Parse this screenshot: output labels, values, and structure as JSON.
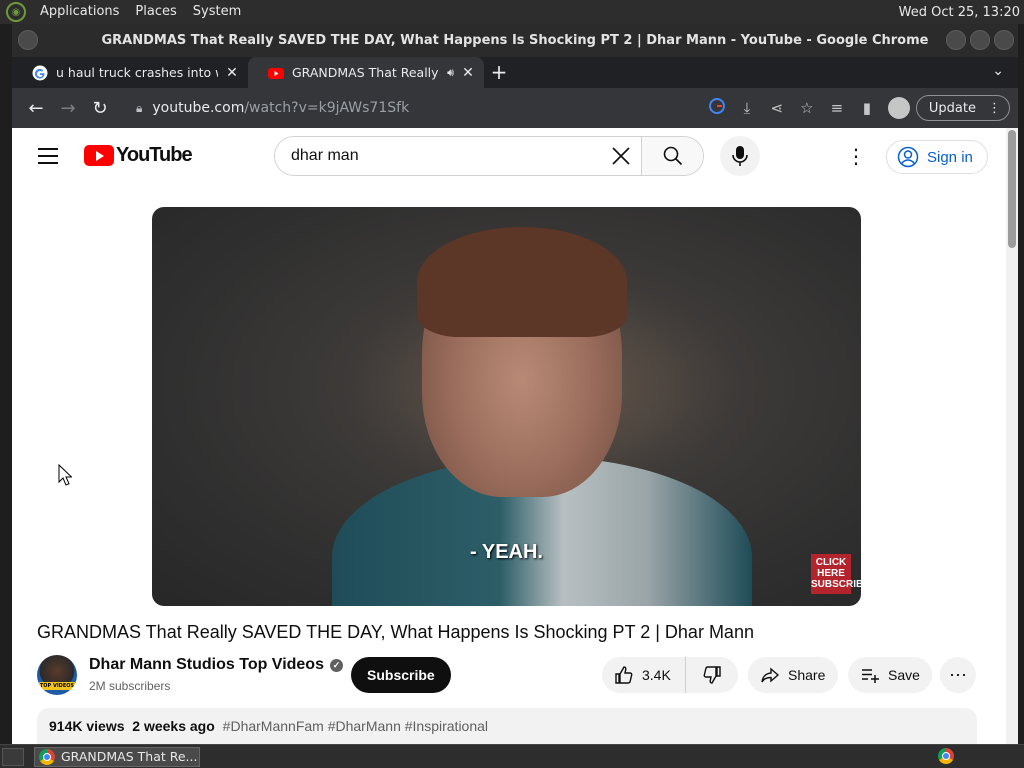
{
  "system_panel": {
    "menus": [
      "Applications",
      "Places",
      "System"
    ],
    "clock": "Wed Oct 25, 13:20"
  },
  "window": {
    "title": "GRANDMAS That Really SAVED THE DAY, What Happens Is Shocking PT 2 | Dhar Mann - YouTube - Google Chrome"
  },
  "tabs": [
    {
      "title": "u haul truck crashes into white",
      "icon": "google-icon",
      "active": false
    },
    {
      "title": "GRANDMAS That Really SAVED",
      "icon": "youtube-icon",
      "active": true,
      "audio": true
    }
  ],
  "toolbar": {
    "url_host": "youtube.com",
    "url_path": "/watch?v=k9jAWs71Sfk",
    "update_label": "Update"
  },
  "youtube": {
    "logo_text": "YouTube",
    "search_value": "dhar man",
    "signin_label": "Sign in",
    "video": {
      "subtitle": "- YEAH.",
      "endcard": "CLICK HERE SUBSCRIBE",
      "title": "GRANDMAS That Really SAVED THE DAY, What Happens Is Shocking PT 2 | Dhar Mann"
    },
    "channel": {
      "name": "Dhar Mann Studios Top Videos",
      "subscribers": "2M subscribers",
      "avatar_badge": "TOP VIDEOS"
    },
    "actions": {
      "subscribe": "Subscribe",
      "likes": "3.4K",
      "share": "Share",
      "save": "Save"
    },
    "description": {
      "views": "914K views",
      "age": "2 weeks ago",
      "tags": "#DharMannFam #DharMann #Inspirational"
    }
  },
  "taskbar": {
    "item_label": "GRANDMAS That Re..."
  },
  "colors": {
    "brand_red": "#ff0000",
    "link_blue": "#065fd4",
    "chrome_dark": "#35363a"
  }
}
